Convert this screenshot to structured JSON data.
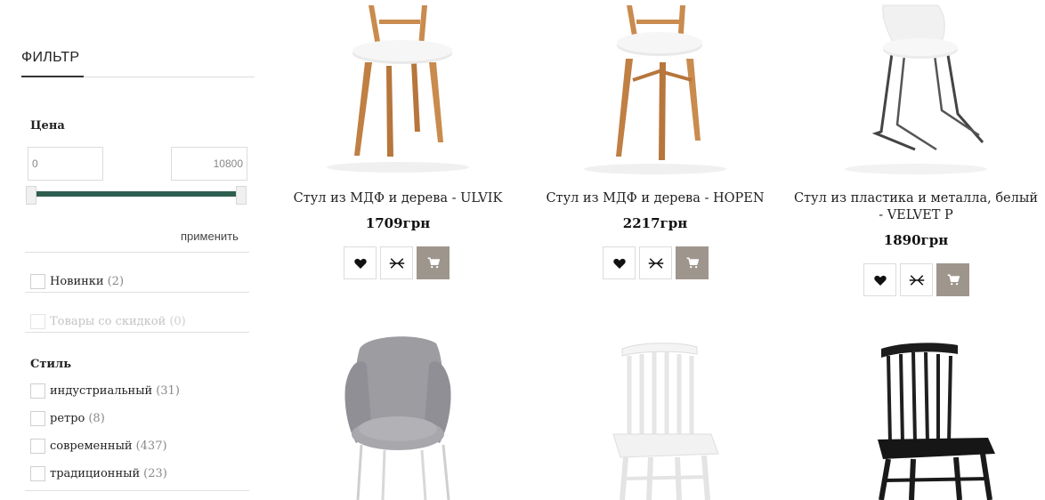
{
  "filter": {
    "title": "ФИЛЬТР",
    "price": {
      "title": "Цена",
      "min_value": "0",
      "max_value": "10800",
      "apply_label": "применить"
    },
    "flags": [
      {
        "label": "Новинки",
        "count": "(2)",
        "disabled": false
      },
      {
        "label": "Товары со скидкой",
        "count": "(0)",
        "disabled": true
      }
    ],
    "style": {
      "title": "Стиль",
      "options": [
        {
          "label": "индустриальный",
          "count": "(31)"
        },
        {
          "label": "ретро",
          "count": "(8)"
        },
        {
          "label": "современный",
          "count": "(437)"
        },
        {
          "label": "традиционный",
          "count": "(23)"
        }
      ]
    }
  },
  "products": [
    {
      "name_line1": "Стул из МДФ и дерева - ULVIK",
      "name_line2": "",
      "price": "1709грн"
    },
    {
      "name_line1": "Стул из МДФ и дерева - HOPEN",
      "name_line2": "",
      "price": "2217грн"
    },
    {
      "name_line1": "Стул из пластика и металла, белый",
      "name_line2": "- VELVET P",
      "price": "1890грн"
    },
    {
      "name_line1": "",
      "name_line2": "",
      "price": ""
    },
    {
      "name_line1": "",
      "name_line2": "",
      "price": ""
    },
    {
      "name_line1": "",
      "name_line2": "",
      "price": ""
    }
  ],
  "icons": {
    "wishlist": "heart-icon",
    "compare": "compare-icon",
    "cart": "cart-icon"
  },
  "colors": {
    "slider": "#2d5e4f",
    "cart_button": "#9e958c"
  }
}
